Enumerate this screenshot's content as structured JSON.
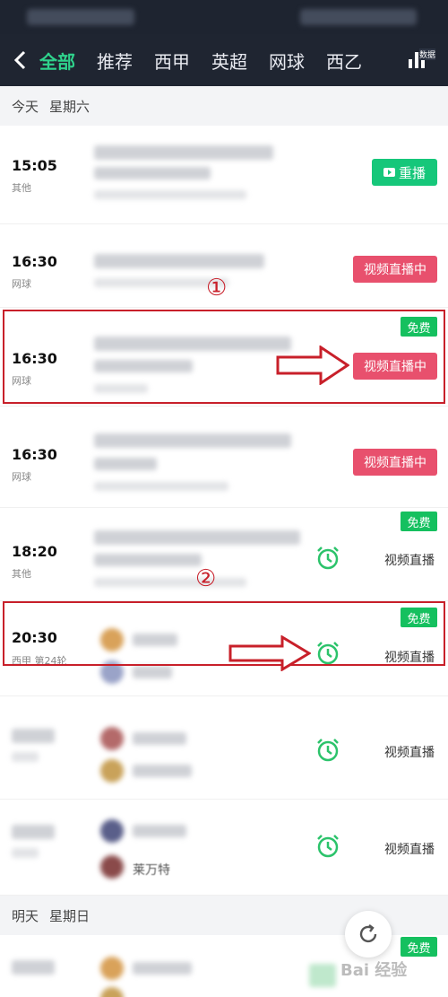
{
  "header": {
    "back_icon": "chevron-left-icon",
    "tabs": [
      {
        "label": "全部",
        "active": true
      },
      {
        "label": "推荐",
        "active": false
      },
      {
        "label": "西甲",
        "active": false
      },
      {
        "label": "英超",
        "active": false
      },
      {
        "label": "网球",
        "active": false
      },
      {
        "label": "西乙",
        "active": false
      }
    ],
    "data_label": "数据"
  },
  "sections": [
    {
      "day": "今天",
      "weekday": "星期六"
    },
    {
      "day": "明天",
      "weekday": "星期日"
    }
  ],
  "matches": [
    {
      "time": "15:05",
      "league": "其他",
      "action": "重播",
      "action_type": "replay"
    },
    {
      "time": "16:30",
      "league": "网球",
      "action": "视频直播中",
      "action_type": "live"
    },
    {
      "time": "16:30",
      "league": "网球",
      "action": "视频直播中",
      "action_type": "live",
      "badge": "免费",
      "highlighted": true
    },
    {
      "time": "16:30",
      "league": "网球",
      "action": "视频直播中",
      "action_type": "live"
    },
    {
      "time": "18:20",
      "league": "其他",
      "action": "视频直播",
      "action_type": "reminder",
      "badge": "免费"
    },
    {
      "time": "20:30",
      "league": "西甲 第24轮",
      "action": "视频直播",
      "action_type": "reminder",
      "badge": "免费",
      "highlighted": true
    },
    {
      "time": "",
      "league": "",
      "action": "视频直播",
      "action_type": "reminder"
    },
    {
      "time": "",
      "league": "",
      "action": "视频直播",
      "action_type": "reminder"
    }
  ],
  "tomorrow_first_row": {
    "badge": "免费"
  },
  "annotations": {
    "marker1": "①",
    "marker2": "②"
  },
  "partial_text": "莱万特",
  "watermark": "Bai 经验",
  "colors": {
    "accent_green": "#2fd28c",
    "replay_green": "#16c77a",
    "live_pink": "#e8506d",
    "free_green": "#15c05f",
    "highlight_red": "#c8202a",
    "nav_bg": "#1f2531"
  }
}
